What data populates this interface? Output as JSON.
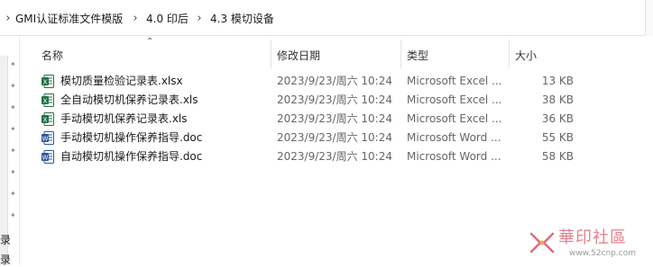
{
  "breadcrumb": {
    "items": [
      "GMI认证标准文件模版",
      "4.0 印后",
      "4.3 模切设备"
    ]
  },
  "nav": {
    "clipped_labels": [
      "录",
      "录"
    ]
  },
  "columns": {
    "name": "名称",
    "modified": "修改日期",
    "type": "类型",
    "size": "大小"
  },
  "files": [
    {
      "name": "模切质量检验记录表.xlsx",
      "modified": "2023/9/23/周六 10:24",
      "type": "Microsoft Excel ...",
      "size": "13 KB",
      "icon": "excel-icon"
    },
    {
      "name": "全自动模切机保养记录表.xls",
      "modified": "2023/9/23/周六 10:24",
      "type": "Microsoft Excel ...",
      "size": "38 KB",
      "icon": "excel-icon"
    },
    {
      "name": "手动模切机保养记录表.xls",
      "modified": "2023/9/23/周六 10:24",
      "type": "Microsoft Excel ...",
      "size": "36 KB",
      "icon": "excel-icon"
    },
    {
      "name": "手动模切机操作保养指导.doc",
      "modified": "2023/9/23/周六 10:24",
      "type": "Microsoft Word ...",
      "size": "55 KB",
      "icon": "word-icon"
    },
    {
      "name": "自动模切机操作保养指导.doc",
      "modified": "2023/9/23/周六 10:24",
      "type": "Microsoft Word ...",
      "size": "58 KB",
      "icon": "word-icon"
    }
  ],
  "watermark": {
    "brand": "華印社區",
    "url": "www.52cnp.com"
  },
  "colors": {
    "excel": "#1f7244",
    "word": "#2b579a",
    "watermark": "#e06b7a"
  }
}
